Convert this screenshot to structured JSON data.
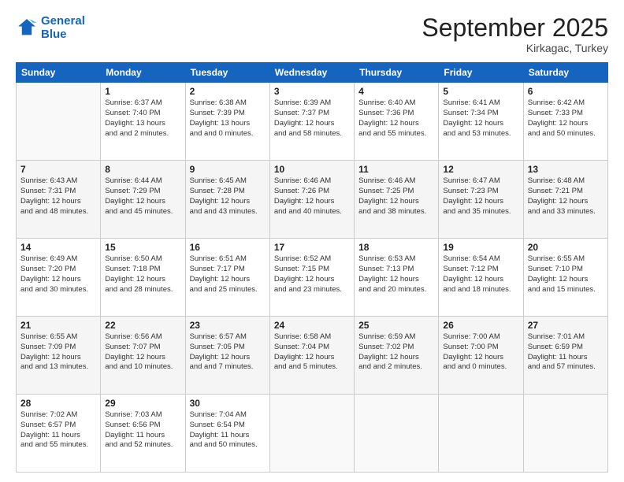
{
  "header": {
    "logo_line1": "General",
    "logo_line2": "Blue",
    "month_title": "September 2025",
    "location": "Kirkagac, Turkey"
  },
  "columns": [
    "Sunday",
    "Monday",
    "Tuesday",
    "Wednesday",
    "Thursday",
    "Friday",
    "Saturday"
  ],
  "weeks": [
    [
      {
        "day": "",
        "sunrise": "",
        "sunset": "",
        "daylight": ""
      },
      {
        "day": "1",
        "sunrise": "Sunrise: 6:37 AM",
        "sunset": "Sunset: 7:40 PM",
        "daylight": "Daylight: 13 hours and 2 minutes."
      },
      {
        "day": "2",
        "sunrise": "Sunrise: 6:38 AM",
        "sunset": "Sunset: 7:39 PM",
        "daylight": "Daylight: 13 hours and 0 minutes."
      },
      {
        "day": "3",
        "sunrise": "Sunrise: 6:39 AM",
        "sunset": "Sunset: 7:37 PM",
        "daylight": "Daylight: 12 hours and 58 minutes."
      },
      {
        "day": "4",
        "sunrise": "Sunrise: 6:40 AM",
        "sunset": "Sunset: 7:36 PM",
        "daylight": "Daylight: 12 hours and 55 minutes."
      },
      {
        "day": "5",
        "sunrise": "Sunrise: 6:41 AM",
        "sunset": "Sunset: 7:34 PM",
        "daylight": "Daylight: 12 hours and 53 minutes."
      },
      {
        "day": "6",
        "sunrise": "Sunrise: 6:42 AM",
        "sunset": "Sunset: 7:33 PM",
        "daylight": "Daylight: 12 hours and 50 minutes."
      }
    ],
    [
      {
        "day": "7",
        "sunrise": "Sunrise: 6:43 AM",
        "sunset": "Sunset: 7:31 PM",
        "daylight": "Daylight: 12 hours and 48 minutes."
      },
      {
        "day": "8",
        "sunrise": "Sunrise: 6:44 AM",
        "sunset": "Sunset: 7:29 PM",
        "daylight": "Daylight: 12 hours and 45 minutes."
      },
      {
        "day": "9",
        "sunrise": "Sunrise: 6:45 AM",
        "sunset": "Sunset: 7:28 PM",
        "daylight": "Daylight: 12 hours and 43 minutes."
      },
      {
        "day": "10",
        "sunrise": "Sunrise: 6:46 AM",
        "sunset": "Sunset: 7:26 PM",
        "daylight": "Daylight: 12 hours and 40 minutes."
      },
      {
        "day": "11",
        "sunrise": "Sunrise: 6:46 AM",
        "sunset": "Sunset: 7:25 PM",
        "daylight": "Daylight: 12 hours and 38 minutes."
      },
      {
        "day": "12",
        "sunrise": "Sunrise: 6:47 AM",
        "sunset": "Sunset: 7:23 PM",
        "daylight": "Daylight: 12 hours and 35 minutes."
      },
      {
        "day": "13",
        "sunrise": "Sunrise: 6:48 AM",
        "sunset": "Sunset: 7:21 PM",
        "daylight": "Daylight: 12 hours and 33 minutes."
      }
    ],
    [
      {
        "day": "14",
        "sunrise": "Sunrise: 6:49 AM",
        "sunset": "Sunset: 7:20 PM",
        "daylight": "Daylight: 12 hours and 30 minutes."
      },
      {
        "day": "15",
        "sunrise": "Sunrise: 6:50 AM",
        "sunset": "Sunset: 7:18 PM",
        "daylight": "Daylight: 12 hours and 28 minutes."
      },
      {
        "day": "16",
        "sunrise": "Sunrise: 6:51 AM",
        "sunset": "Sunset: 7:17 PM",
        "daylight": "Daylight: 12 hours and 25 minutes."
      },
      {
        "day": "17",
        "sunrise": "Sunrise: 6:52 AM",
        "sunset": "Sunset: 7:15 PM",
        "daylight": "Daylight: 12 hours and 23 minutes."
      },
      {
        "day": "18",
        "sunrise": "Sunrise: 6:53 AM",
        "sunset": "Sunset: 7:13 PM",
        "daylight": "Daylight: 12 hours and 20 minutes."
      },
      {
        "day": "19",
        "sunrise": "Sunrise: 6:54 AM",
        "sunset": "Sunset: 7:12 PM",
        "daylight": "Daylight: 12 hours and 18 minutes."
      },
      {
        "day": "20",
        "sunrise": "Sunrise: 6:55 AM",
        "sunset": "Sunset: 7:10 PM",
        "daylight": "Daylight: 12 hours and 15 minutes."
      }
    ],
    [
      {
        "day": "21",
        "sunrise": "Sunrise: 6:55 AM",
        "sunset": "Sunset: 7:09 PM",
        "daylight": "Daylight: 12 hours and 13 minutes."
      },
      {
        "day": "22",
        "sunrise": "Sunrise: 6:56 AM",
        "sunset": "Sunset: 7:07 PM",
        "daylight": "Daylight: 12 hours and 10 minutes."
      },
      {
        "day": "23",
        "sunrise": "Sunrise: 6:57 AM",
        "sunset": "Sunset: 7:05 PM",
        "daylight": "Daylight: 12 hours and 7 minutes."
      },
      {
        "day": "24",
        "sunrise": "Sunrise: 6:58 AM",
        "sunset": "Sunset: 7:04 PM",
        "daylight": "Daylight: 12 hours and 5 minutes."
      },
      {
        "day": "25",
        "sunrise": "Sunrise: 6:59 AM",
        "sunset": "Sunset: 7:02 PM",
        "daylight": "Daylight: 12 hours and 2 minutes."
      },
      {
        "day": "26",
        "sunrise": "Sunrise: 7:00 AM",
        "sunset": "Sunset: 7:00 PM",
        "daylight": "Daylight: 12 hours and 0 minutes."
      },
      {
        "day": "27",
        "sunrise": "Sunrise: 7:01 AM",
        "sunset": "Sunset: 6:59 PM",
        "daylight": "Daylight: 11 hours and 57 minutes."
      }
    ],
    [
      {
        "day": "28",
        "sunrise": "Sunrise: 7:02 AM",
        "sunset": "Sunset: 6:57 PM",
        "daylight": "Daylight: 11 hours and 55 minutes."
      },
      {
        "day": "29",
        "sunrise": "Sunrise: 7:03 AM",
        "sunset": "Sunset: 6:56 PM",
        "daylight": "Daylight: 11 hours and 52 minutes."
      },
      {
        "day": "30",
        "sunrise": "Sunrise: 7:04 AM",
        "sunset": "Sunset: 6:54 PM",
        "daylight": "Daylight: 11 hours and 50 minutes."
      },
      {
        "day": "",
        "sunrise": "",
        "sunset": "",
        "daylight": ""
      },
      {
        "day": "",
        "sunrise": "",
        "sunset": "",
        "daylight": ""
      },
      {
        "day": "",
        "sunrise": "",
        "sunset": "",
        "daylight": ""
      },
      {
        "day": "",
        "sunrise": "",
        "sunset": "",
        "daylight": ""
      }
    ]
  ]
}
